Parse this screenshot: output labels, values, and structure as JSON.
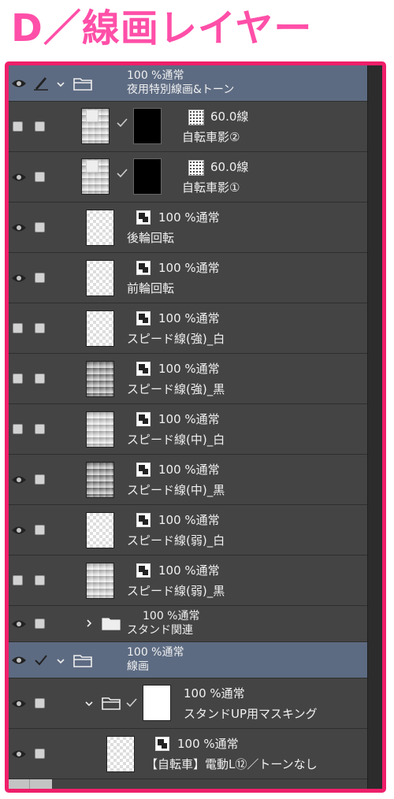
{
  "title": "D／線画レイヤー",
  "colors": {
    "accent": "#ef1f6a",
    "title": "#ff4fa8",
    "selected": "#5d6b82",
    "panel": "#434343"
  },
  "layers": [
    {
      "kind": "folder",
      "mode": "100 %通常",
      "name": "夜用特別線画&トーン",
      "eye": true,
      "pen": true,
      "selected": true,
      "expanded": true
    },
    {
      "kind": "tone",
      "mode": "60.0線",
      "name": "自転車影②",
      "eye": false
    },
    {
      "kind": "tone",
      "mode": "60.0線",
      "name": "自転車影①",
      "eye": true
    },
    {
      "kind": "layer",
      "mode": "100 %通常",
      "name": "後輪回転",
      "eye": true
    },
    {
      "kind": "layer",
      "mode": "100 %通常",
      "name": "前輪回転",
      "eye": true
    },
    {
      "kind": "layer",
      "mode": "100 %通常",
      "name": "スピード線(強)_白",
      "eye": false
    },
    {
      "kind": "layer",
      "mode": "100 %通常",
      "name": "スピード線(強)_黒",
      "eye": false
    },
    {
      "kind": "layer",
      "mode": "100 %通常",
      "name": "スピード線(中)_白",
      "eye": false
    },
    {
      "kind": "layer",
      "mode": "100 %通常",
      "name": "スピード線(中)_黒",
      "eye": true
    },
    {
      "kind": "layer",
      "mode": "100 %通常",
      "name": "スピード線(弱)_白",
      "eye": true
    },
    {
      "kind": "layer",
      "mode": "100 %通常",
      "name": "スピード線(弱)_黒",
      "eye": false
    },
    {
      "kind": "folder",
      "mode": "100 %通常",
      "name": "スタンド関連",
      "eye": true,
      "expanded": false
    },
    {
      "kind": "folder",
      "mode": "100 %通常",
      "name": "線画",
      "eye": true,
      "selected": true,
      "expanded": true,
      "checked": true
    },
    {
      "kind": "mask",
      "mode": "100 %通常",
      "name": "スタンドUP用マスキング",
      "eye": true
    },
    {
      "kind": "layer",
      "mode": "100 %通常",
      "name": "【自転車】電動L⑫／トーンなし",
      "eye": true
    }
  ]
}
